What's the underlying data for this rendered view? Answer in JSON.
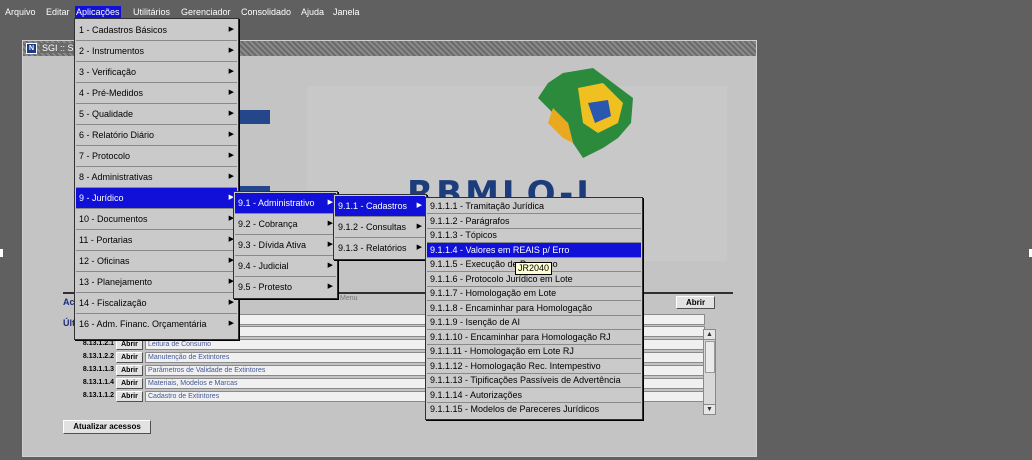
{
  "menubar": [
    "Arquivo",
    "Editar",
    "Aplicações",
    "Utilitários",
    "Gerenciador",
    "Consolidado",
    "Ajuda",
    "Janela"
  ],
  "window": {
    "title": "SGI :: S"
  },
  "banner": {
    "logo_text": "RBMLQ-I"
  },
  "menu_hint": "Menu",
  "acessos": {
    "label": "Ac",
    "abrir_label": "Abrir",
    "ultimos_label": "Últ"
  },
  "recent_rows": [
    {
      "code": "",
      "button": "",
      "name": ""
    },
    {
      "code": "",
      "button": "",
      "name": ""
    },
    {
      "code": "8.13.1.2.1",
      "button": "Abrir",
      "name": "Leitura de Consumo"
    },
    {
      "code": "8.13.1.2.2",
      "button": "Abrir",
      "name": "Manutenção de Extintores"
    },
    {
      "code": "8.13.1.1.3",
      "button": "Abrir",
      "name": "Parâmetros de Validade de Extintores"
    },
    {
      "code": "8.13.1.1.4",
      "button": "Abrir",
      "name": "Materiais, Modelos e Marcas"
    },
    {
      "code": "8.13.1.1.2",
      "button": "Abrir",
      "name": "Cadastro de Extintores"
    }
  ],
  "atualizar_label": "Atualizar acessos",
  "aplicacoes_menu": [
    "1 - Cadastros Básicos",
    "2 - Instrumentos",
    "3 - Verificação",
    "4 - Pré-Medidos",
    "5 - Qualidade",
    "6 - Relatório Diário",
    "7 - Protocolo",
    "8 - Administrativas",
    "9 - Jurídico",
    "10 - Documentos",
    "11 - Portarias",
    "12 - Oficinas",
    "13 - Planejamento",
    "14 - Fiscalização",
    "16 - Adm. Financ. Orçamentária"
  ],
  "juridico_menu": [
    "9.1 - Administrativo",
    "9.2 - Cobrança",
    "9.3 - Dívida Ativa",
    "9.4 - Judicial",
    "9.5 - Protesto"
  ],
  "administrativo_menu": [
    "9.1.1 - Cadastros",
    "9.1.2 - Consultas",
    "9.1.3 - Relatórios"
  ],
  "cadastros_menu": [
    "9.1.1.1 - Tramitação Jurídica",
    "9.1.1.2 - Parágrafos",
    "9.1.1.3 - Tópicos",
    "9.1.1.4 - Valores em REAIS p/ Erro",
    "9.1.1.5 - Execução de Processo",
    "9.1.1.6 - Protocolo Jurídico em Lote",
    "9.1.1.7 - Homologação em Lote",
    "9.1.1.8 - Encaminhar para Homologação",
    "9.1.1.9 - Isenção de AI",
    "9.1.1.10 - Encaminhar para Homologação RJ",
    "9.1.1.11 - Homologação em Lote RJ",
    "9.1.1.12 - Homologação Rec. Intempestivo",
    "9.1.1.13 - Tipificações Passíveis de Advertência",
    "9.1.1.14 - Autorizações",
    "9.1.1.15 - Modelos de Pareceres Jurídicos"
  ],
  "tooltip": "JR2040",
  "colors": {
    "highlight": "#1010d8",
    "background": "#606060",
    "menu_bg": "#cacaca",
    "logo_blue": "#1c3c7c"
  }
}
